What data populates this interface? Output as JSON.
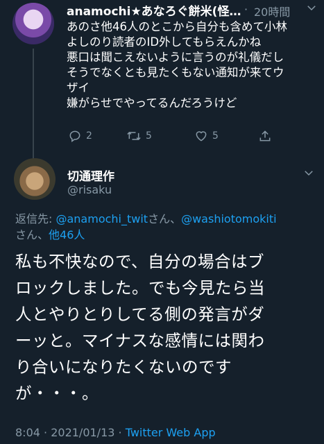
{
  "tweet1": {
    "display_name": "anamochi★あなろぐ餅米(怪…",
    "separator": "·",
    "time": "20時間",
    "text": "あのさ他46人のとこから自分も含めて小林\nよしのり読者のID外してもらえんかね\n悪口は聞こえないように言うのが礼儀だし\nそうでなくとも見たくもない通知が来てウ\nザイ\n嫌がらせでやってるんだろうけど",
    "reply_count": "2",
    "retweet_count": "5",
    "like_count": "5"
  },
  "tweet2": {
    "display_name": "切通理作",
    "handle": "@risaku",
    "reply_prefix": "返信先: ",
    "mention1": "@anamochi_twit",
    "san1": "さん、",
    "mention2": "@washiotomokiti",
    "san2_line": "さん、",
    "others": "他46人",
    "text": "私も不快なので、自分の場合はブ\nロックしました。でも今見たら当\n人とやりとりしてる側の発言がダ\nーッと。マイナスな感情には関わ\nり合いになりたくないのです\nが・・・。",
    "time": "8:04",
    "dot": " · ",
    "date": "2021/01/13",
    "dot2": " · ",
    "source": "Twitter Web App"
  },
  "colors": {
    "background": "#15202b",
    "secondary_text": "#8899a6",
    "link": "#1da1f2"
  }
}
